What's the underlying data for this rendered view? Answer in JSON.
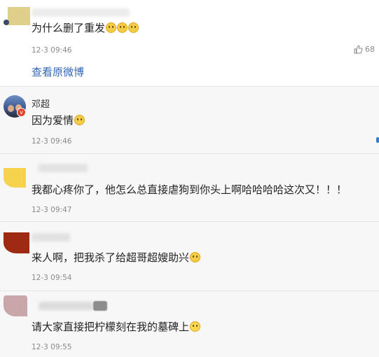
{
  "first_reply": {
    "text": "为什么删了重发",
    "time": "12-3 09:46",
    "like_count": "68",
    "view_original": "查看原微博"
  },
  "comments": [
    {
      "username": "邓超",
      "text": "因为爱情",
      "time": "12-3 09:46"
    },
    {
      "username": "",
      "text": "我都心疼你了，他怎么总直接虐狗到你头上啊哈哈哈哈这次又！！！",
      "time": "12-3 09:47"
    },
    {
      "username": "",
      "text": "来人啊，把我杀了给超哥超嫂助兴",
      "time": "12-3 09:54"
    },
    {
      "username": "",
      "text": "请大家直接把柠檬刻在我的墓碑上",
      "time": "12-3 09:55"
    }
  ],
  "colors": {
    "link": "#3267b5",
    "background": "#f7f7f7",
    "verified_badge": "#e0452a"
  },
  "icons": [
    "thumbs-up-icon",
    "verified-badge-icon",
    "laughing-emoji-icon",
    "thinking-emoji-icon"
  ]
}
